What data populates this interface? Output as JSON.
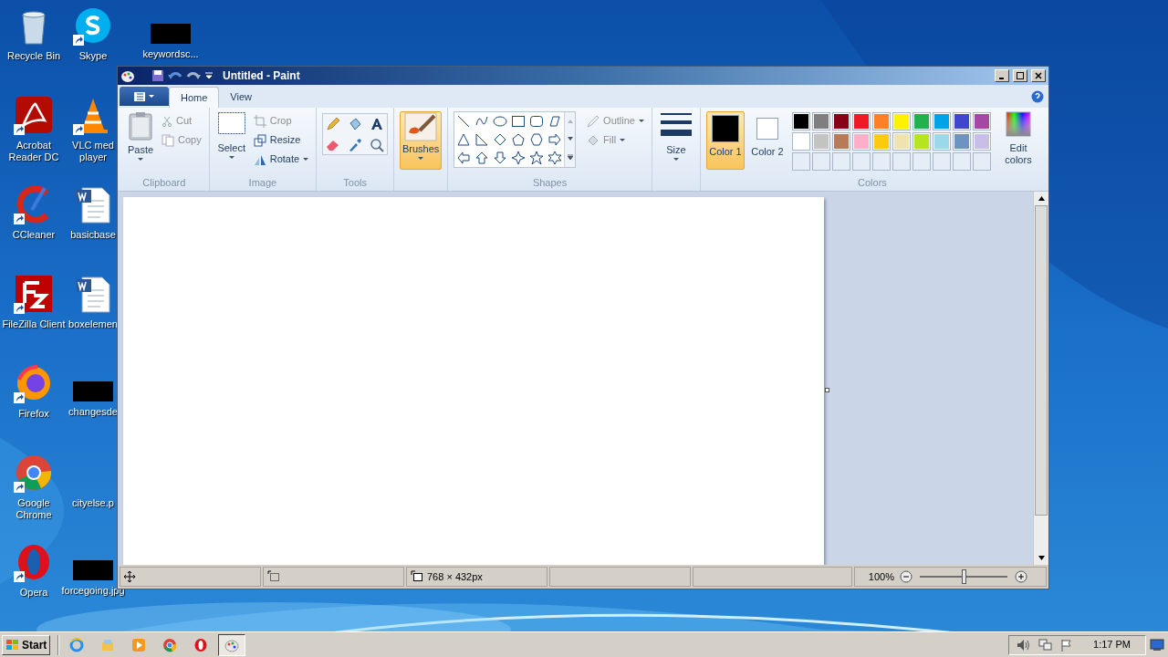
{
  "desktop_icons": [
    {
      "label": "Recycle Bin",
      "kind": "recycle",
      "shortcut": false
    },
    {
      "label": "Skype",
      "kind": "skype",
      "shortcut": true
    },
    {
      "label": "keywordsc...",
      "kind": "redacted",
      "shortcut": false
    },
    {
      "label": "Acrobat Reader DC",
      "kind": "acrobat",
      "shortcut": true
    },
    {
      "label": "VLC med player",
      "kind": "vlc",
      "shortcut": true
    },
    {
      "label": "CCleaner",
      "kind": "ccleaner",
      "shortcut": true
    },
    {
      "label": "basicbase",
      "kind": "word",
      "shortcut": false
    },
    {
      "label": "FileZilla Client",
      "kind": "filezilla",
      "shortcut": true
    },
    {
      "label": "boxelemen",
      "kind": "word",
      "shortcut": false
    },
    {
      "label": "Firefox",
      "kind": "firefox",
      "shortcut": true
    },
    {
      "label": "changesde",
      "kind": "redacted",
      "shortcut": false
    },
    {
      "label": "Google Chrome",
      "kind": "chrome",
      "shortcut": true
    },
    {
      "label": "cityelse.p",
      "kind": "blank",
      "shortcut": false
    },
    {
      "label": "Opera",
      "kind": "opera",
      "shortcut": true
    },
    {
      "label": "forcegoing.jpg",
      "kind": "redacted",
      "shortcut": false
    }
  ],
  "window": {
    "title": "Untitled - Paint"
  },
  "ribbon_tabs": [
    {
      "label": "Home",
      "selected": true
    },
    {
      "label": "View",
      "selected": false
    }
  ],
  "clipboard": {
    "paste": "Paste",
    "cut": {
      "label": "Cut",
      "disabled": true
    },
    "copy": {
      "label": "Copy",
      "disabled": true
    },
    "group": "Clipboard"
  },
  "image": {
    "select": "Select",
    "crop": {
      "label": "Crop",
      "disabled": true
    },
    "resize": {
      "label": "Resize",
      "disabled": false
    },
    "rotate": {
      "label": "Rotate",
      "disabled": false
    },
    "group": "Image"
  },
  "tools": {
    "group": "Tools"
  },
  "brushes": {
    "label": "Brushes",
    "selected": true
  },
  "shapes": {
    "outline": {
      "label": "Outline",
      "disabled": true
    },
    "fill": {
      "label": "Fill",
      "disabled": true
    },
    "group": "Shapes"
  },
  "size": {
    "label": "Size"
  },
  "colors": {
    "color1": {
      "label": "Color 1",
      "color": "#000000",
      "selected": true
    },
    "color2": {
      "label": "Color 2",
      "color": "#ffffff",
      "selected": false
    },
    "palette": [
      {
        "color": "#000000"
      },
      {
        "color": "#7f7f7f"
      },
      {
        "color": "#880015"
      },
      {
        "color": "#ed1c24"
      },
      {
        "color": "#ff7f27"
      },
      {
        "color": "#fff200"
      },
      {
        "color": "#22b14c"
      },
      {
        "color": "#00a2e8"
      },
      {
        "color": "#3f48cc"
      },
      {
        "color": "#a349a4"
      },
      {
        "color": "#ffffff"
      },
      {
        "color": "#c3c3c3"
      },
      {
        "color": "#b97a57"
      },
      {
        "color": "#ffaec9"
      },
      {
        "color": "#ffc90e"
      },
      {
        "color": "#efe4b0"
      },
      {
        "color": "#b5e61d"
      },
      {
        "color": "#99d9ea"
      },
      {
        "color": "#7092be"
      },
      {
        "color": "#c8bfe7"
      }
    ],
    "edit": "Edit colors",
    "group": "Colors"
  },
  "status_bar": {
    "dimensions": "768 × 432px",
    "zoom": "100%",
    "zoom_level": {
      "level": 0.5
    }
  },
  "taskbar": {
    "start": "Start",
    "time": "1:17 PM",
    "apps": [
      {
        "kind": "ie",
        "selected": false
      },
      {
        "kind": "explorer",
        "selected": false
      },
      {
        "kind": "media",
        "selected": false
      },
      {
        "kind": "chrome",
        "selected": false
      },
      {
        "kind": "opera",
        "selected": false
      },
      {
        "kind": "paint",
        "selected": true
      }
    ]
  }
}
